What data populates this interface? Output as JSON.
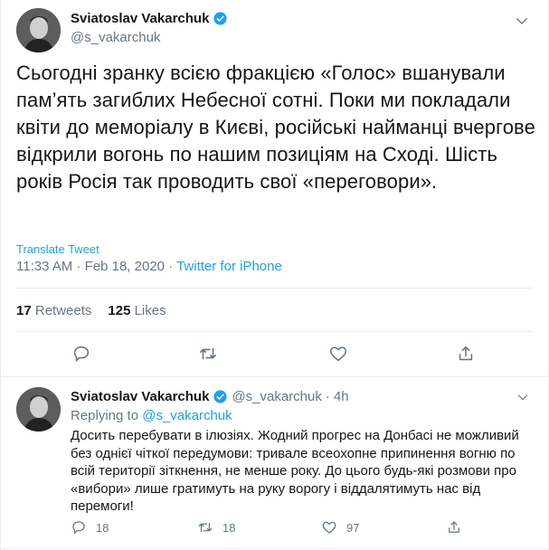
{
  "main_tweet": {
    "author_name": "Sviatoslav Vakarchuk",
    "handle": "@s_vakarchuk",
    "text": "Сьогодні зранку всією фракцією  «Голос» вшанували пам’ять загиблих Небесної сотні. Поки ми покладали квіти до меморіалу в Києві, російські найманці вчергове відкрили вогонь по нашим позиціям на Сході. Шість років Росія так проводить свої «переговори».",
    "translate_label": "Translate Tweet",
    "time": "11:33 AM",
    "dot": "·",
    "date": "Feb 18, 2020",
    "source": "Twitter for iPhone",
    "retweets_count": "17",
    "retweets_label": "Retweets",
    "likes_count": "125",
    "likes_label": "Likes"
  },
  "reply_tweet": {
    "author_name": "Sviatoslav Vakarchuk",
    "handle": "@s_vakarchuk",
    "dot": "·",
    "age": "4h",
    "replying_prefix": "Replying to",
    "replying_to": "@s_vakarchuk",
    "text": "Досить перебувати в ілюзіях. Жодний прогрес на Донбасі не можливий без однієї чіткої передумови: тривале всеохопне припинення вогню по всій території зіткнення, не менше року. До цього будь-які розмови про «вибори» лише гратимуть на руку ворогу і віддалятимуть нас від перемоги!",
    "reply_count": "18",
    "retweet_count": "18",
    "like_count": "97"
  },
  "colors": {
    "accent": "#1da1f2",
    "secondary_text": "#657786",
    "divider": "#e6ecf0"
  },
  "icons": [
    "verified-badge-icon",
    "chevron-down-icon",
    "reply-icon",
    "retweet-icon",
    "like-icon",
    "share-icon"
  ]
}
